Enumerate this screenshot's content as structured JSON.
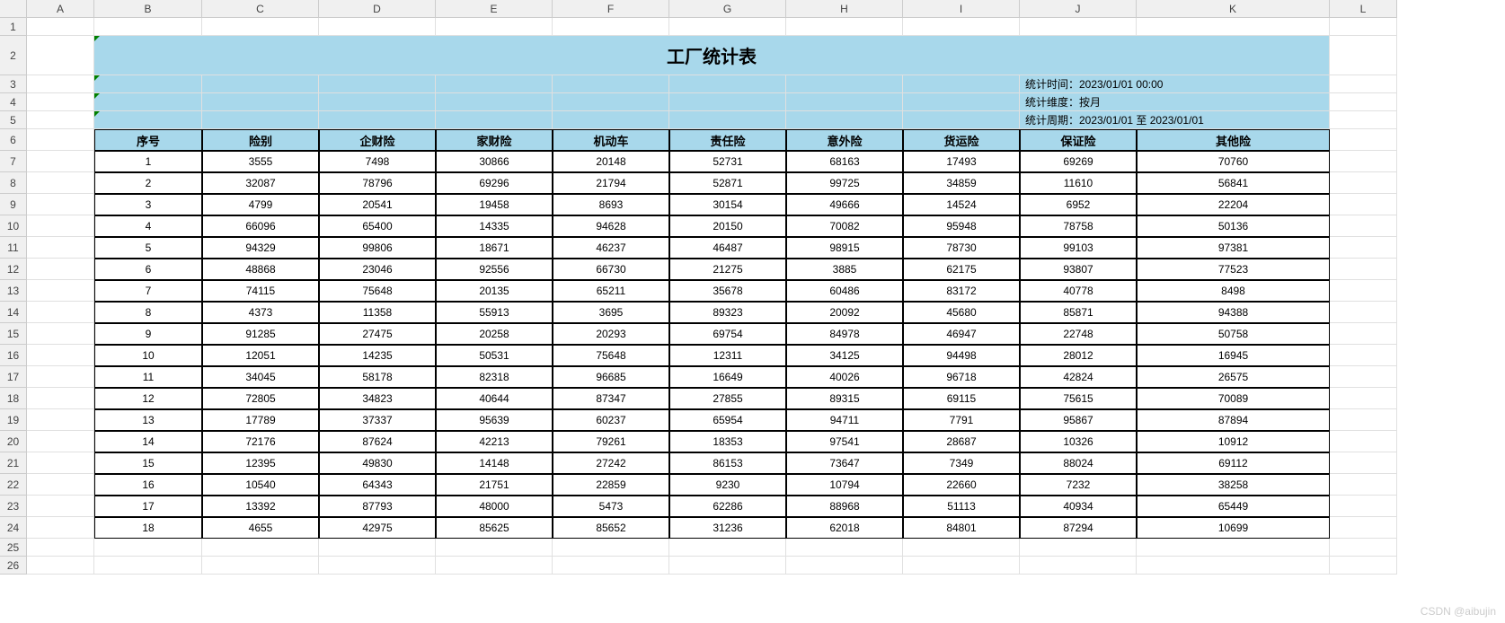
{
  "columns": {
    "letters": [
      "A",
      "B",
      "C",
      "D",
      "E",
      "F",
      "G",
      "H",
      "I",
      "J",
      "K",
      "L"
    ],
    "widths": [
      75,
      120,
      130,
      130,
      130,
      130,
      130,
      130,
      130,
      130,
      215,
      75
    ]
  },
  "row_heights": {
    "default": 20,
    "r1": 20,
    "r2": 44,
    "r3": 20,
    "r4": 20,
    "r5": 20,
    "r6": 24,
    "data": 24
  },
  "title": "工厂统计表",
  "meta": {
    "line1": "统计时间：2023/01/01 00:00",
    "line2": "统计维度：按月",
    "line3": "统计周期：2023/01/01 至 2023/01/01"
  },
  "headers": [
    "序号",
    "险别",
    "企财险",
    "家财险",
    "机动车",
    "责任险",
    "意外险",
    "货运险",
    "保证险",
    "其他险"
  ],
  "chart_data": {
    "type": "table",
    "title": "工厂统计表",
    "columns": [
      "序号",
      "险别",
      "企财险",
      "家财险",
      "机动车",
      "责任险",
      "意外险",
      "货运险",
      "保证险",
      "其他险"
    ],
    "rows": [
      [
        1,
        3555,
        7498,
        30866,
        20148,
        52731,
        68163,
        17493,
        69269,
        70760
      ],
      [
        2,
        32087,
        78796,
        69296,
        21794,
        52871,
        99725,
        34859,
        11610,
        56841
      ],
      [
        3,
        4799,
        20541,
        19458,
        8693,
        30154,
        49666,
        14524,
        6952,
        22204
      ],
      [
        4,
        66096,
        65400,
        14335,
        94628,
        20150,
        70082,
        95948,
        78758,
        50136
      ],
      [
        5,
        94329,
        99806,
        18671,
        46237,
        46487,
        98915,
        78730,
        99103,
        97381
      ],
      [
        6,
        48868,
        23046,
        92556,
        66730,
        21275,
        3885,
        62175,
        93807,
        77523
      ],
      [
        7,
        74115,
        75648,
        20135,
        65211,
        35678,
        60486,
        83172,
        40778,
        8498
      ],
      [
        8,
        4373,
        11358,
        55913,
        3695,
        89323,
        20092,
        45680,
        85871,
        94388
      ],
      [
        9,
        91285,
        27475,
        20258,
        20293,
        69754,
        84978,
        46947,
        22748,
        50758
      ],
      [
        10,
        12051,
        14235,
        50531,
        75648,
        12311,
        34125,
        94498,
        28012,
        16945
      ],
      [
        11,
        34045,
        58178,
        82318,
        96685,
        16649,
        40026,
        96718,
        42824,
        26575
      ],
      [
        12,
        72805,
        34823,
        40644,
        87347,
        27855,
        89315,
        69115,
        75615,
        70089
      ],
      [
        13,
        17789,
        37337,
        95639,
        60237,
        65954,
        94711,
        7791,
        95867,
        87894
      ],
      [
        14,
        72176,
        87624,
        42213,
        79261,
        18353,
        97541,
        28687,
        10326,
        10912
      ],
      [
        15,
        12395,
        49830,
        14148,
        27242,
        86153,
        73647,
        7349,
        88024,
        69112
      ],
      [
        16,
        10540,
        64343,
        21751,
        22859,
        9230,
        10794,
        22660,
        7232,
        38258
      ],
      [
        17,
        13392,
        87793,
        48000,
        5473,
        62286,
        88968,
        51113,
        40934,
        65449
      ],
      [
        18,
        4655,
        42975,
        85625,
        85652,
        31236,
        62018,
        84801,
        87294,
        10699
      ]
    ]
  },
  "watermark": "CSDN @aibujin"
}
